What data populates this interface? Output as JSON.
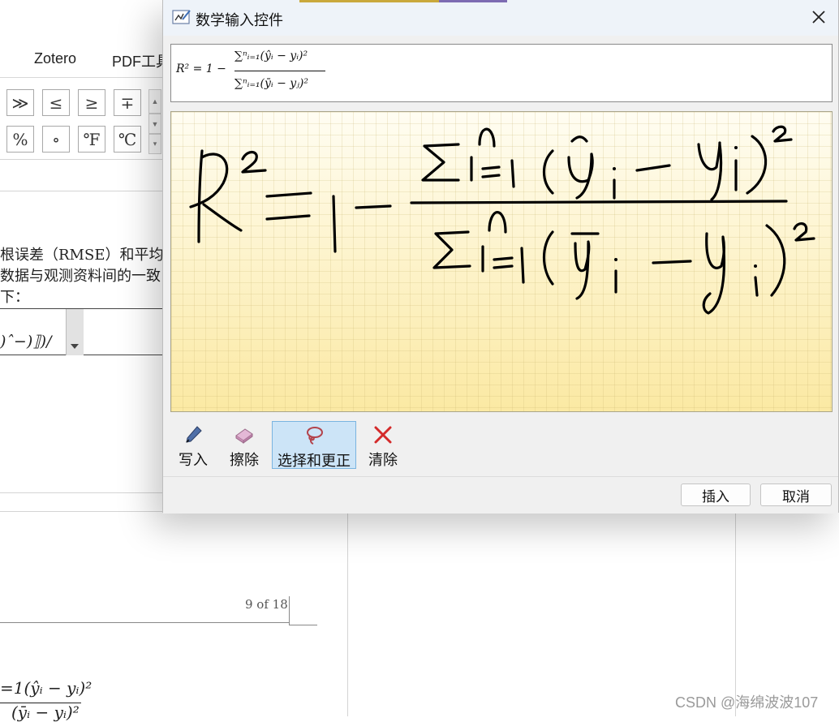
{
  "background_app": {
    "tabs": [
      "ǀ",
      "Zotero",
      "PDF工具"
    ],
    "symbol_buttons": {
      "row1": [
        "≫",
        "≤",
        "≥",
        "∓"
      ],
      "row2": [
        "%",
        "∘",
        "℉",
        "℃"
      ]
    },
    "doc_lines": [
      "根误差（RMSE）和平均",
      "数据与观测资料间的一致",
      "下："
    ],
    "formula_fragment": ")ˆ−)⟧)/",
    "page_indicator": "9 of 18",
    "bottom_formula_top": "=1(ŷᵢ − yᵢ)²",
    "bottom_formula_bottom": "(ȳᵢ − yᵢ)²"
  },
  "dialog": {
    "title": "数学输入控件",
    "preview": {
      "lhs": "R² = 1 −",
      "numerator": "∑ⁿᵢ₌₁(ŷᵢ − yᵢ)²",
      "denominator": "∑ⁿᵢ₌₁(ȳᵢ − yⱼ)²"
    },
    "tools": [
      {
        "label": "写入",
        "icon": "pen-icon",
        "active": false
      },
      {
        "label": "擦除",
        "icon": "eraser-icon",
        "active": false
      },
      {
        "label": "选择和更正",
        "icon": "lasso-icon",
        "active": true
      },
      {
        "label": "清除",
        "icon": "clear-x-icon",
        "active": false
      }
    ],
    "buttons": {
      "insert": "插入",
      "cancel": "取消"
    }
  },
  "watermark": "CSDN @海绵波波107",
  "colors": {
    "ink_bg": "#fff7cc",
    "active_tool": "#cce4f7",
    "title_bar": "#eef3f9"
  }
}
